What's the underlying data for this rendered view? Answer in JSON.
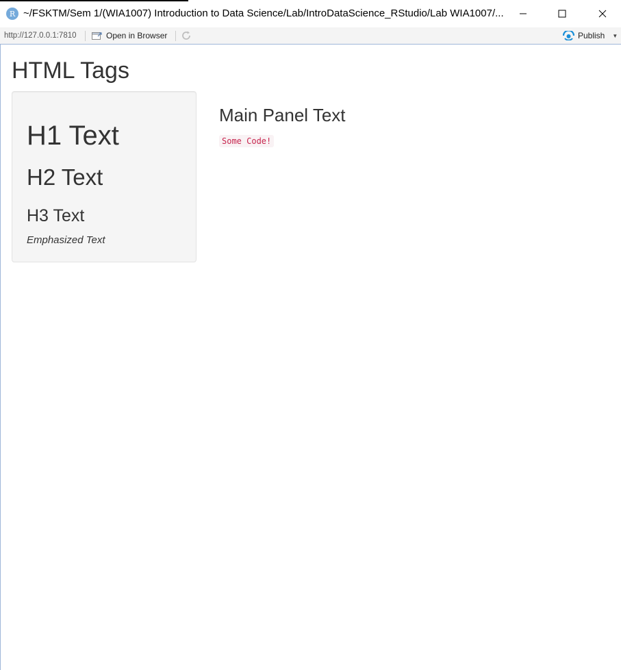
{
  "window": {
    "title": "~/FSKTM/Sem 1/(WIA1007) Introduction to Data Science/Lab/IntroDataScience_RStudio/Lab WIA1007/...",
    "app_icon_letter": "R",
    "buttons": [
      "minimize",
      "maximize",
      "close"
    ]
  },
  "toolbar": {
    "url": "http://127.0.0.1:7810",
    "open_in_browser_label": "Open in Browser",
    "publish_label": "Publish"
  },
  "page": {
    "title": "HTML Tags"
  },
  "sidebar": {
    "h1": "H1 Text",
    "h2": "H2 Text",
    "h3": "H3 Text",
    "em": "Emphasized Text"
  },
  "main": {
    "heading": "Main Panel Text",
    "code": "Some Code!"
  },
  "colors": {
    "accent": "#75aadb",
    "code_text": "#c7254e",
    "code_bg": "#f9f2f4",
    "well_bg": "#f5f5f5",
    "publish_icon": "#1a8fd8"
  }
}
